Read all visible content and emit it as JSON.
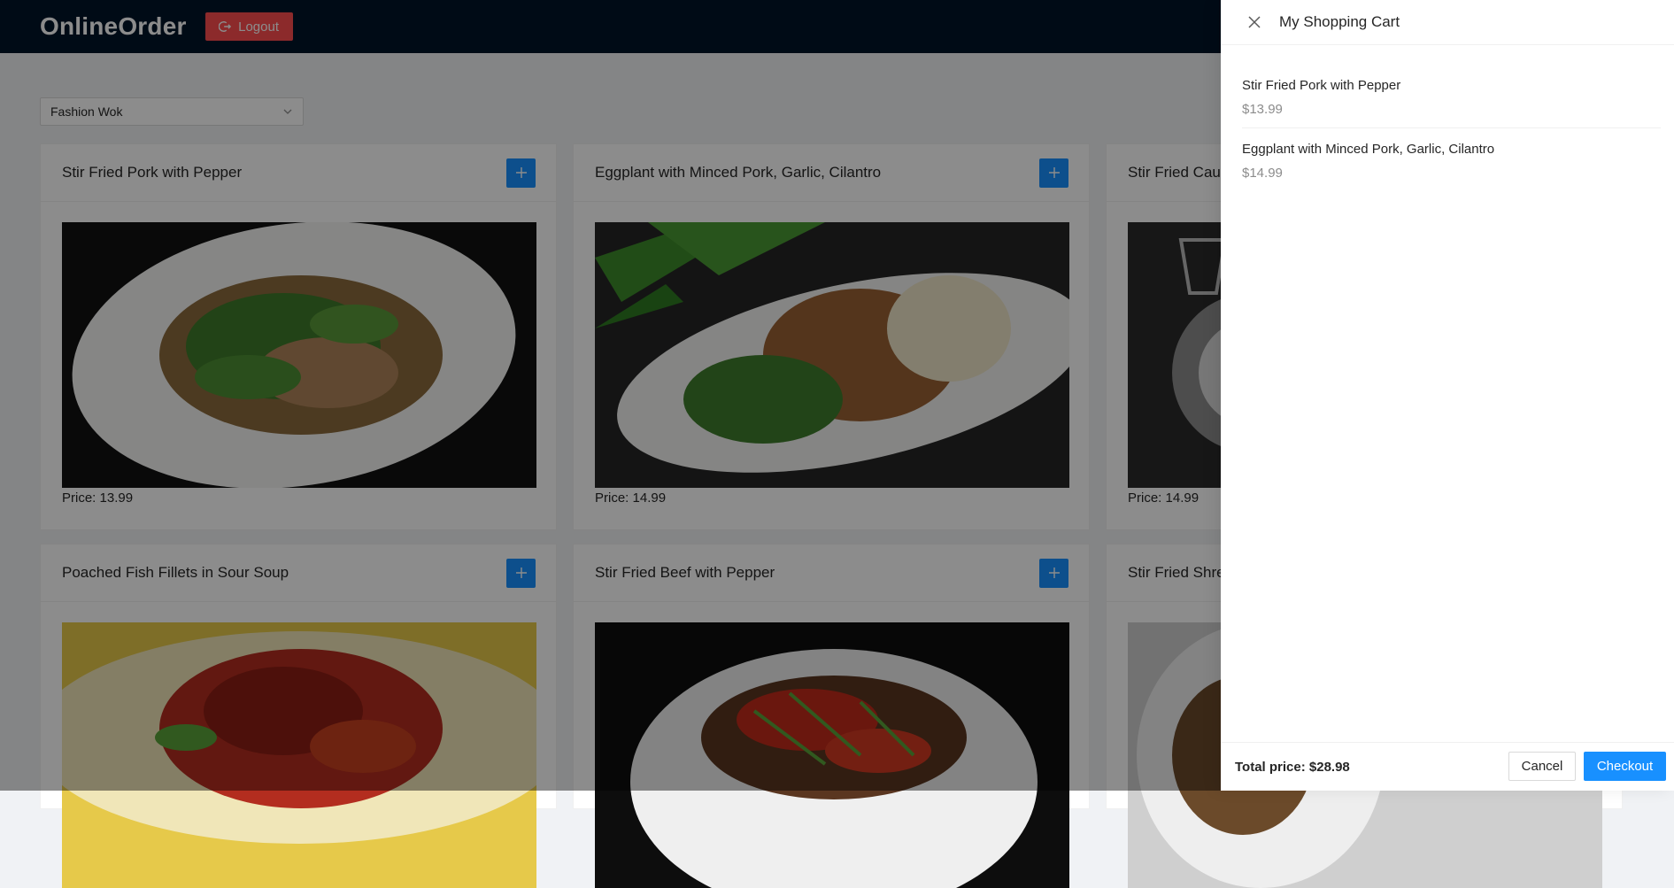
{
  "header": {
    "brand": "OnlineOrder",
    "logout_label": "Logout"
  },
  "restaurant_select": {
    "value": "Fashion Wok"
  },
  "menu": [
    {
      "name": "Stir Fried Pork with Pepper",
      "price": "Price: 13.99"
    },
    {
      "name": "Eggplant with Minced Pork, Garlic, Cilantro",
      "price": "Price: 14.99"
    },
    {
      "name": "Stir Fried Cauliflower",
      "price": "Price: 14.99"
    },
    {
      "name": "Poached Fish Fillets in Sour Soup",
      "price": ""
    },
    {
      "name": "Stir Fried Beef with Pepper",
      "price": ""
    },
    {
      "name": "Stir Fried Shredded",
      "price": ""
    }
  ],
  "cart": {
    "title": "My Shopping Cart",
    "items": [
      {
        "name": "Stir Fried Pork with Pepper",
        "price": "$13.99"
      },
      {
        "name": "Eggplant with Minced Pork, Garlic, Cilantro",
        "price": "$14.99"
      }
    ],
    "total": "Total price: $28.98",
    "cancel_label": "Cancel",
    "checkout_label": "Checkout"
  },
  "colors": {
    "header_bg": "#001529",
    "logout_bg": "#ff4d4f",
    "primary": "#1890ff"
  }
}
